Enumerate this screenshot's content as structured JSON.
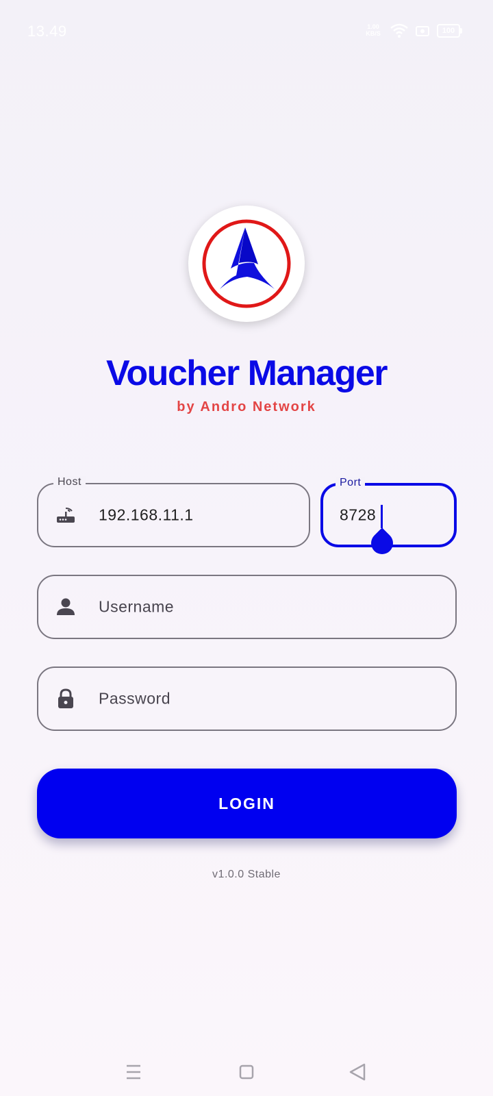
{
  "status_bar": {
    "time": "13.49",
    "network": "1.00 KB/S",
    "battery": "100"
  },
  "app": {
    "title": "Voucher Manager",
    "subtitle": "by Andro Network",
    "version": "v1.0.0 Stable"
  },
  "form": {
    "host": {
      "label": "Host",
      "value": "192.168.11.1",
      "icon": "router-icon"
    },
    "port": {
      "label": "Port",
      "value": "8728"
    },
    "username": {
      "placeholder": "Username",
      "icon": "person-icon"
    },
    "password": {
      "placeholder": "Password",
      "icon": "lock-icon"
    },
    "login_label": "LOGIN"
  },
  "colors": {
    "brand_blue": "#0a0ae6",
    "subtitle_red": "#e34545",
    "logo_ring_red": "#e01818"
  },
  "nav": {
    "icons": [
      "menu-icon",
      "home-icon",
      "back-icon"
    ]
  }
}
